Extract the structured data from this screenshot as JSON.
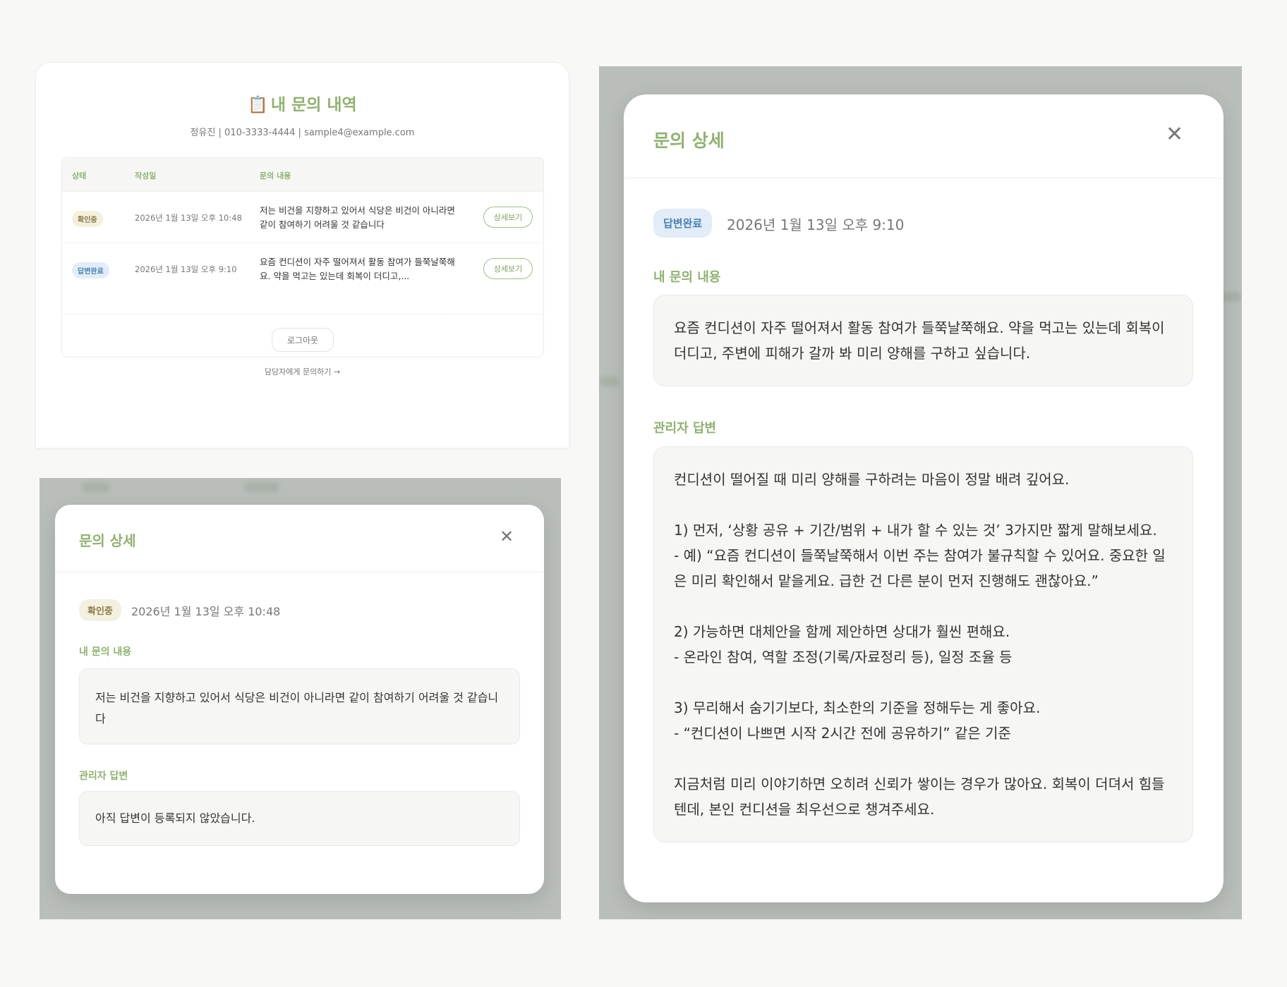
{
  "list": {
    "title_emoji": "📋",
    "title": "내 문의 내역",
    "user_info": "정유진 | 010-3333-4444 | sample4@example.com",
    "columns": {
      "status": "상태",
      "date": "작성일",
      "content": "문의 내용"
    },
    "rows": [
      {
        "status": "확인중",
        "date": "2026년 1월 13일 오후 10:48",
        "content": "저는 비건을 지향하고 있어서 식당은 비건이 아니라면 같이 참여하기 어려울 것 같습니다",
        "button": "상세보기"
      },
      {
        "status": "답변완료",
        "date": "2026년 1월 13일 오후 9:10",
        "content": "요즘 컨디션이 자주 떨어져서 활동 참여가 들쭉날쭉해요. 약을 먹고는 있는데 회복이 더디고,...",
        "button": "상세보기"
      }
    ],
    "logout": "로그아웃",
    "contact": "담당자에게 문의하기 →"
  },
  "modal_small": {
    "title": "문의 상세",
    "close": "✕",
    "status": "확인중",
    "date": "2026년 1월 13일 오후 10:48",
    "question_label": "내 문의 내용",
    "question": "저는 비건을 지향하고 있어서 식당은 비건이 아니라면 같이 참여하기 어려울 것 같습니다",
    "answer_label": "관리자 답변",
    "answer": "아직 답변이 등록되지 않았습니다."
  },
  "modal_large": {
    "title": "문의 상세",
    "close": "✕",
    "status": "답변완료",
    "date": "2026년 1월 13일 오후 9:10",
    "question_label": "내 문의 내용",
    "question": "요즘 컨디션이 자주 떨어져서 활동 참여가 들쭉날쭉해요. 약을 먹고는 있는데 회복이 더디고, 주변에 피해가 갈까 봐 미리 양해를 구하고 싶습니다.",
    "answer_label": "관리자 답변",
    "answer": "컨디션이 떨어질 때 미리 양해를 구하려는 마음이 정말 배려 깊어요.\n\n1) 먼저, ‘상황 공유 + 기간/범위 + 내가 할 수 있는 것’ 3가지만 짧게 말해보세요.\n- 예) “요즘 컨디션이 들쭉날쭉해서 이번 주는 참여가 불규칙할 수 있어요. 중요한 일은 미리 확인해서 맡을게요. 급한 건 다른 분이 먼저 진행해도 괜찮아요.”\n\n2) 가능하면 대체안을 함께 제안하면 상대가 훨씬 편해요.\n- 온라인 참여, 역할 조정(기록/자료정리 등), 일정 조율 등\n\n3) 무리해서 숨기기보다, 최소한의 기준을 정해두는 게 좋아요.\n- “컨디션이 나쁘면 시작 2시간 전에 공유하기” 같은 기준\n\n지금처럼 미리 이야기하면 오히려 신뢰가 쌓이는 경우가 많아요. 회복이 더뎌서 힘들텐데, 본인 컨디션을 최우선으로 챙겨주세요."
  },
  "colors": {
    "accent_green": "#8fb26f",
    "pending_bg": "#f4f0df",
    "done_bg": "#e2edf8",
    "overlay": "#b9beba"
  }
}
